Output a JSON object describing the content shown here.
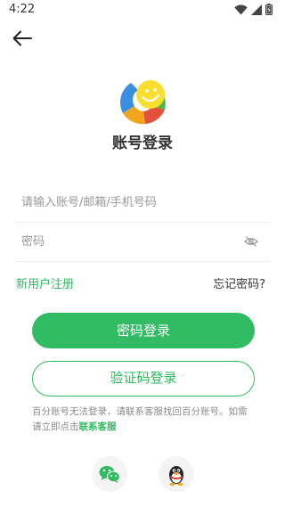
{
  "status": {
    "time": "4:22"
  },
  "page": {
    "title": "账号登录"
  },
  "form": {
    "account_placeholder": "请输入账号/邮箱/手机号码",
    "password_placeholder": "密码"
  },
  "links": {
    "register": "新用户注册",
    "forgot": "忘记密码?"
  },
  "buttons": {
    "password_login": "密码登录",
    "code_login": "验证码登录"
  },
  "note": {
    "text": "百分账号无法登录，请联系客服找回百分账号。如需请立即点击",
    "link": "联系客服"
  },
  "colors": {
    "accent": "#31bb62",
    "link_green": "#2dbb5d"
  },
  "icons": {
    "back": "arrow-left-icon",
    "eye": "eye-off-icon",
    "wechat": "wechat-icon",
    "qq": "qq-penguin-icon"
  }
}
